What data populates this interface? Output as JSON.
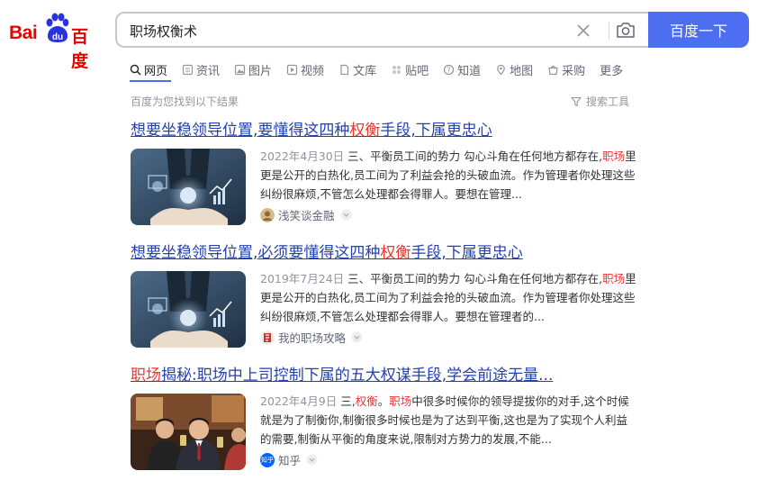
{
  "logo": {
    "bai": "Bai",
    "du": "百度"
  },
  "search": {
    "query": "职场权衡术",
    "button_label": "百度一下"
  },
  "tabs": [
    {
      "label": "网页",
      "icon": "search-icon",
      "active": true
    },
    {
      "label": "资讯",
      "icon": "news-icon"
    },
    {
      "label": "图片",
      "icon": "image-icon"
    },
    {
      "label": "视频",
      "icon": "video-icon"
    },
    {
      "label": "文库",
      "icon": "document-icon"
    },
    {
      "label": "贴吧",
      "icon": "tieba-icon"
    },
    {
      "label": "知道",
      "icon": "question-icon"
    },
    {
      "label": "地图",
      "icon": "map-icon"
    },
    {
      "label": "采购",
      "icon": "shopping-icon"
    },
    {
      "label": "更多"
    }
  ],
  "result_count": "百度为您找到以下结果",
  "tools_label": "搜索工具",
  "results": [
    {
      "title_before": "想要坐稳领导位置,要懂得这四种",
      "title_hl": "权衡",
      "title_after": "手段,下属更忠心",
      "date": "2022年4月30日",
      "snippet_1": "三、平衡员工间的势力 勾心斗角在任何地方都存在,",
      "snippet_hl": "职场",
      "snippet_2": "里更是公开的白热化,员工间为了利益会抢的头破血流。作为管理者你处理这些纠纷很麻烦,不管怎么处理都会得罪人。要想在管理...",
      "source": "浅笑谈金融"
    },
    {
      "title_before": "想要坐稳领导位置,必须要懂得这四种",
      "title_hl": "权衡",
      "title_after": "手段,下属更忠心",
      "date": "2019年7月24日",
      "snippet_1": "三、平衡员工间的势力 勾心斗角在任何地方都存在,",
      "snippet_hl": "职场",
      "snippet_2": "里更是公开的白热化,员工间为了利益会抢的头破血流。作为管理者你处理这些纠纷很麻烦,不管怎么处理都会得罪人。要想在管理者的...",
      "source": "我的职场攻略"
    },
    {
      "title_hl": "职场",
      "title_after": "揭秘:职场中上司控制下属的五大权谋手段,学会前途无量...",
      "date": "2022年4月9日",
      "snippet_pre": "三,",
      "snippet_hl_a": "权衡",
      "snippet_mid": "。",
      "snippet_hl_b": "职场",
      "snippet_2": "中很多时候你的领导提拔你的对手,这个时候就是为了制衡你,制衡很多时候也是为了达到平衡,这也是为了实现个人利益的需要,制衡从平衡的角度来说,限制对方势力的发展,不能...",
      "source": "知乎",
      "source_icon_text": "知乎"
    }
  ],
  "colors": {
    "brand_blue": "#4e6ef2",
    "link": "#2440b3",
    "highlight": "#f73131",
    "logo_red": "#e10602"
  }
}
